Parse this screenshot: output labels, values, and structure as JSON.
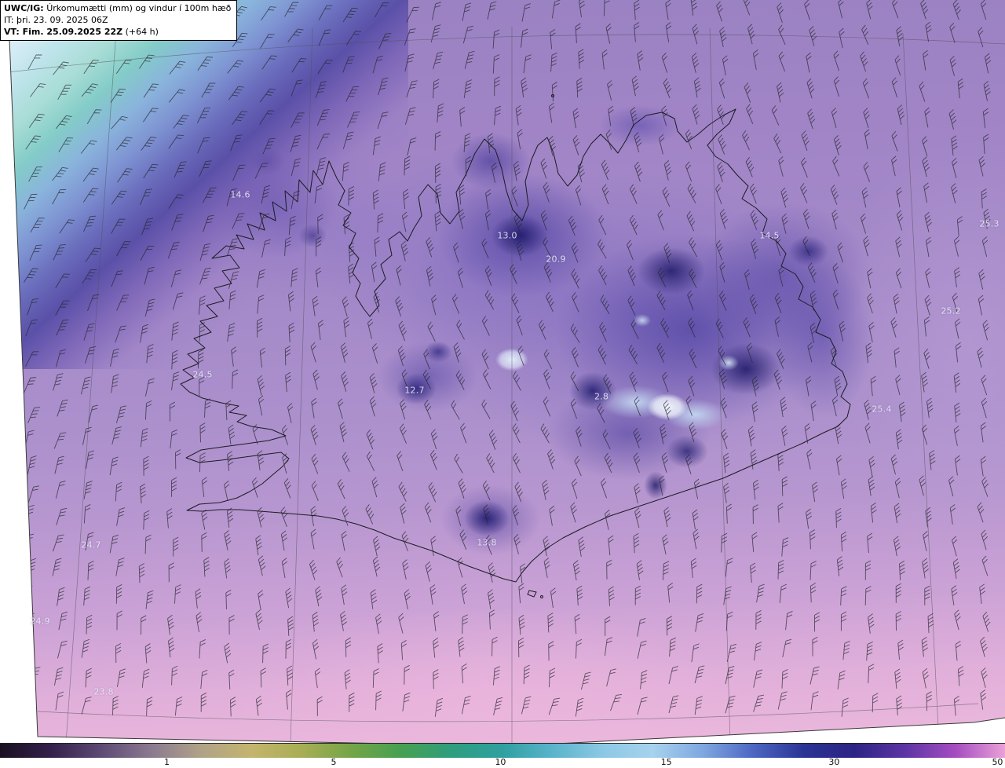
{
  "header": {
    "model": "UWC/IG:",
    "title": "Úrkomumætti (mm) og vindur í 100m hæð",
    "init_time": "IT: þri. 23. 09. 2025 06Z",
    "valid_time": "VT: Fim. 25.09.2025 22Z",
    "lead_time": "(+64 h)"
  },
  "spot_values": [
    {
      "value": "14.6"
    },
    {
      "value": "13.0"
    },
    {
      "value": "20.9"
    },
    {
      "value": "14.5"
    },
    {
      "value": "25.3"
    },
    {
      "value": "25.2"
    },
    {
      "value": "24.5"
    },
    {
      "value": "12.7"
    },
    {
      "value": "2.8"
    },
    {
      "value": "25.4"
    },
    {
      "value": "24.7"
    },
    {
      "value": "13.8"
    },
    {
      "value": "24.9"
    },
    {
      "value": "23.8"
    }
  ],
  "colorbar": {
    "ticks": [
      {
        "label": "1"
      },
      {
        "label": "5"
      },
      {
        "label": "10"
      },
      {
        "label": "15"
      },
      {
        "label": "30"
      },
      {
        "label": "50"
      }
    ],
    "gradient": [
      "#1a1022",
      "#33204a",
      "#5c4a74",
      "#8a7a90",
      "#b0a288",
      "#c4b46e",
      "#a8ae54",
      "#74a448",
      "#46a052",
      "#2e9e7e",
      "#2fa0a0",
      "#5ab4cc",
      "#8cc8e4",
      "#a6d2ee",
      "#7ea6e0",
      "#4c66c2",
      "#2a3494",
      "#2c2484",
      "#5c34a4",
      "#a44cc0",
      "#eba0d8"
    ]
  }
}
